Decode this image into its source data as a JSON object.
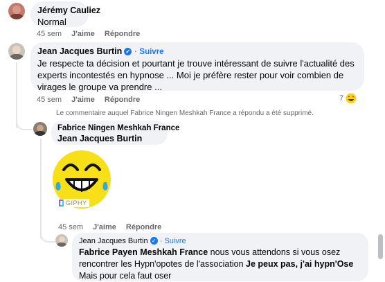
{
  "comments": [
    {
      "author": "Jérémy Cauliez",
      "text": "Normal",
      "time": "45 sem",
      "like": "J'aime",
      "reply": "Répondre"
    },
    {
      "author": "Jean Jacques Burtin",
      "follow": "Suivre",
      "text": "Je respecte ta décision et pourtant je trouve intéressant de suivre l'actualité des experts incontestés en hypnose ... Moi je préfère rester pour voir combien de virages le groupe va prendre ...",
      "time": "45 sem",
      "like": "J'aime",
      "reply": "Répondre",
      "reaction_count": "7"
    }
  ],
  "deleted_notice": "Le commentaire auquel Fabrice Ningen Meshkah France a répondu a été supprimé.",
  "reply1": {
    "author": "Fabrice Ningen Meshkah France",
    "mention": "Jean Jacques Burtin",
    "gif_label": "GIPHY",
    "time": "45 sem",
    "like": "J'aime",
    "reply": "Répondre"
  },
  "reply2": {
    "author": "Jean Jacques Burtin",
    "follow": "Suivre",
    "mention": "Fabrice Payen Meshkah France",
    "text_a": " nous vous attendons si vous osez rencontrer les Hypn'opotes de l'association ",
    "bold_phrase": "Je peux pas, j'ai hypn'Ose",
    "text_b": "Mais pour cela faut oser"
  },
  "colors": {
    "accent": "#1877f2",
    "bubble": "#f0f2f5",
    "meta": "#65676b",
    "emoji_yellow": "#f7e017"
  }
}
